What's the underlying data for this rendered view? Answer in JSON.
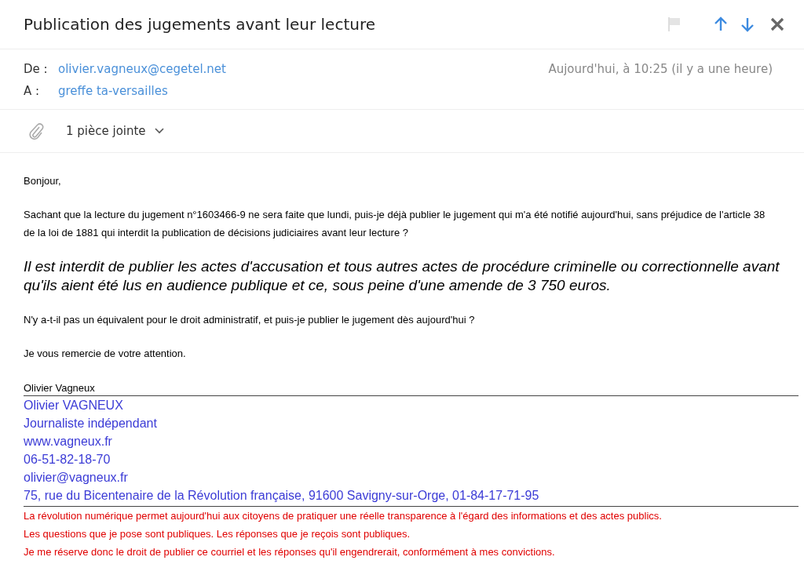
{
  "header": {
    "subject": "Publication des jugements avant leur lecture",
    "flagged": false
  },
  "meta": {
    "from_label": "De :",
    "from": "olivier.vagneux@cegetel.net",
    "date": "Aujourd'hui, à 10:25 (il y a une heure)",
    "to_label": "A :",
    "to": "greffe ta-versailles"
  },
  "attachments": {
    "label": "1 pièce jointe",
    "expanded": false
  },
  "body": [
    {
      "kind": "text",
      "text": "Bonjour,"
    },
    {
      "kind": "text",
      "text": "Sachant que la lecture du jugement n°1603466-9 ne sera faite que lundi, puis-je déjà publier le jugement qui m'a été notifié aujourd'hui, sans préjudice de l'article 38 de la loi de 1881 qui interdit la publication de décisions judiciaires avant leur lecture ?"
    },
    {
      "kind": "quote",
      "text": "Il est interdit de publier les actes d'accusation et tous autres actes de procédure criminelle ou correctionnelle avant qu'ils aient été lus en audience publique et ce, sous peine d'une amende de 3 750 euros."
    },
    {
      "kind": "text",
      "text": "N'y a-t-il pas un équivalent pour le droit administratif, et puis-je publier le jugement dès aujourd'hui ?"
    },
    {
      "kind": "text",
      "text": "Je vous remercie de votre attention."
    }
  ],
  "signature": {
    "name": "Olivier Vagneux",
    "lines": [
      "Olivier VAGNEUX",
      "Journaliste indépendant",
      "www.vagneux.fr",
      "06-51-82-18-70",
      "olivier@vagneux.fr",
      "75, rue du Bicentenaire de la Révolution française, 91600 Savigny-sur-Orge, 01-84-17-71-95"
    ],
    "notice": [
      "La révolution numérique permet aujourd'hui aux citoyens de pratiquer une réelle transparence à l'égard des informations et des actes publics.",
      "Les questions que je pose sont publiques. Les réponses que je reçois sont publiques.",
      "Je me réserve donc le droit de publier ce courriel et les réponses qu'il engendrerait, conformément à mes convictions."
    ]
  }
}
